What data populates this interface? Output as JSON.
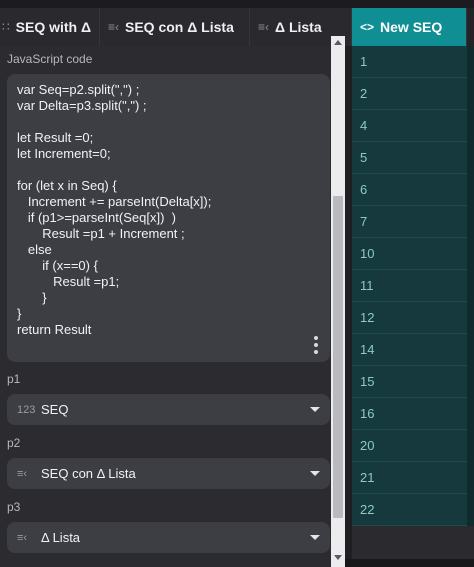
{
  "tabs": [
    {
      "icon": "dots-lines-icon",
      "icon_glyph": "∷",
      "label": "SEQ with Δ"
    },
    {
      "icon": "list-text-icon",
      "icon_glyph": "≡‹",
      "label": "SEQ con Δ Lista"
    },
    {
      "icon": "list-text-icon",
      "icon_glyph": "≡‹",
      "label": "Δ Lista"
    },
    {
      "icon": "code-icon",
      "icon_glyph": "<>",
      "label": "New SEQ"
    }
  ],
  "colors": {
    "accent": "#0f8f94",
    "panel": "#2b2b30",
    "field": "#3d3d44",
    "column": "#15393c"
  },
  "editor": {
    "label": "JavaScript code",
    "code": "var Seq=p2.split(\",\") ;\nvar Delta=p3.split(\",\") ;\n\nlet Result =0;\nlet Increment=0;\n\nfor (let x in Seq) {\n   Increment += parseInt(Delta[x]);\n   if (p1>=parseInt(Seq[x])  )\n       Result =p1 + Increment ;\n   else\n       if (x==0) {\n          Result =p1;\n       }\n}\nreturn Result"
  },
  "params": [
    {
      "label": "p1",
      "icon": "number-type-icon",
      "icon_glyph": "123",
      "value": "SEQ"
    },
    {
      "label": "p2",
      "icon": "text-list-icon",
      "icon_glyph": "≡‹",
      "value": "SEQ con Δ Lista"
    },
    {
      "label": "p3",
      "icon": "text-list-icon",
      "icon_glyph": "≡‹",
      "value": "Δ Lista"
    }
  ],
  "new_seq_values": [
    "1",
    "2",
    "4",
    "5",
    "6",
    "7",
    "10",
    "11",
    "12",
    "14",
    "15",
    "16",
    "20",
    "21",
    "22"
  ]
}
